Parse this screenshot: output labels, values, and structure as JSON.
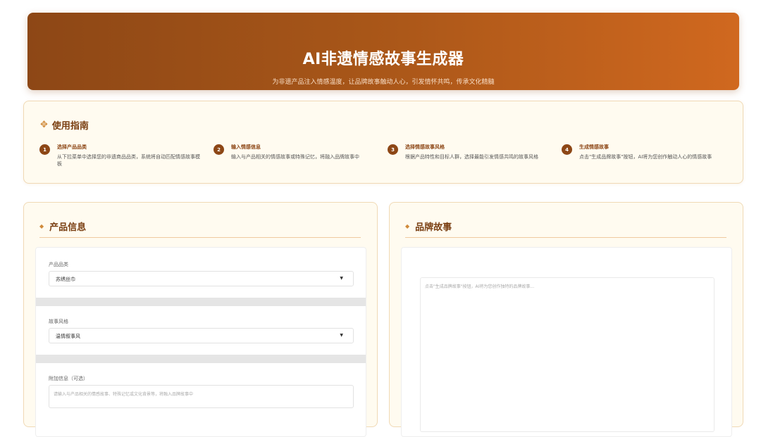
{
  "header": {
    "title": "AI非遗情感故事生成器",
    "subtitle": "为非遗产品注入情感温度，让品牌故事触动人心，引发情怀共鸣，传承文化精髓"
  },
  "guide": {
    "icon": "sparkle-icon",
    "title": "使用指南",
    "steps": [
      {
        "num": "1",
        "title": "选择产品品类",
        "desc": "从下拉菜单中选择您的非遗商品品类，系统将自动匹配情感故事模板"
      },
      {
        "num": "2",
        "title": "输入情感信息",
        "desc": "输入与产品相关的情感故事或特殊记忆，将融入品牌故事中"
      },
      {
        "num": "3",
        "title": "选择情感故事风格",
        "desc": "根据产品特性和目标人群，选择最能引发情感共鸣的故事风格"
      },
      {
        "num": "4",
        "title": "生成情感故事",
        "desc": "点击\"生成品牌故事\"按钮，AI将为您创作触动人心的情感故事"
      }
    ]
  },
  "product_panel": {
    "title": "产品信息",
    "category_label": "产品品类",
    "category_value": "苏绣丝巾",
    "style_label": "故事风格",
    "style_value": "温情叙事风",
    "extra_label": "附加信息（可选）",
    "extra_placeholder": "请输入与产品相关的情感故事、特殊记忆或文化背景等，将融入品牌故事中"
  },
  "story_panel": {
    "title": "品牌故事",
    "placeholder": "点击\"生成品牌故事\"按钮，AI将为您创作独特的品牌故事..."
  },
  "colors": {
    "accent": "#8d4716",
    "accent_light": "#d0681f",
    "panel_bg": "#fffbf0",
    "border": "#f0d9b5"
  }
}
